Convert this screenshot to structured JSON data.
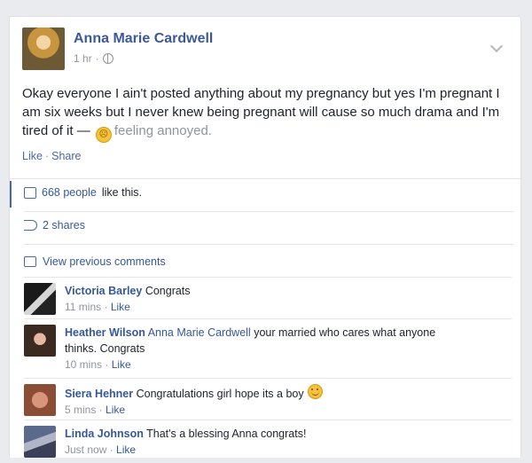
{
  "post": {
    "author": "Anna Marie Cardwell",
    "time": "1 hr",
    "text": "Okay everyone I ain't posted anything about my pregnancy but yes I'm pregnant I am six weeks but I never knew being pregnant will cause so much drama and I'm tired of it —",
    "feeling": "feeling annoyed.",
    "actions": {
      "like": "Like",
      "share": "Share"
    }
  },
  "ufi": {
    "likes": {
      "people": "668 people",
      "suffix": "like this."
    },
    "shares": "2 shares",
    "view_previous": "View previous comments"
  },
  "comments": [
    {
      "name": "Victoria Barley",
      "text": "Congrats",
      "time": "11 mins",
      "like": "Like"
    },
    {
      "name": "Heather Wilson",
      "tag": "Anna Marie Cardwell",
      "text": "your married who cares what anyone",
      "text2": "thinks. Congrats",
      "time": "10 mins",
      "like": "Like"
    },
    {
      "name": "Siera Hehner",
      "text": "Congratulations girl hope its a boy",
      "time": "5 mins",
      "like": "Like"
    },
    {
      "name": "Linda Johnson",
      "text": "That's a blessing Anna congrats!",
      "time": "Just now",
      "like": "Like"
    }
  ],
  "colors": {
    "link": "#365899",
    "secondary_text": "#90949c",
    "emoji": "#f5c23a"
  }
}
